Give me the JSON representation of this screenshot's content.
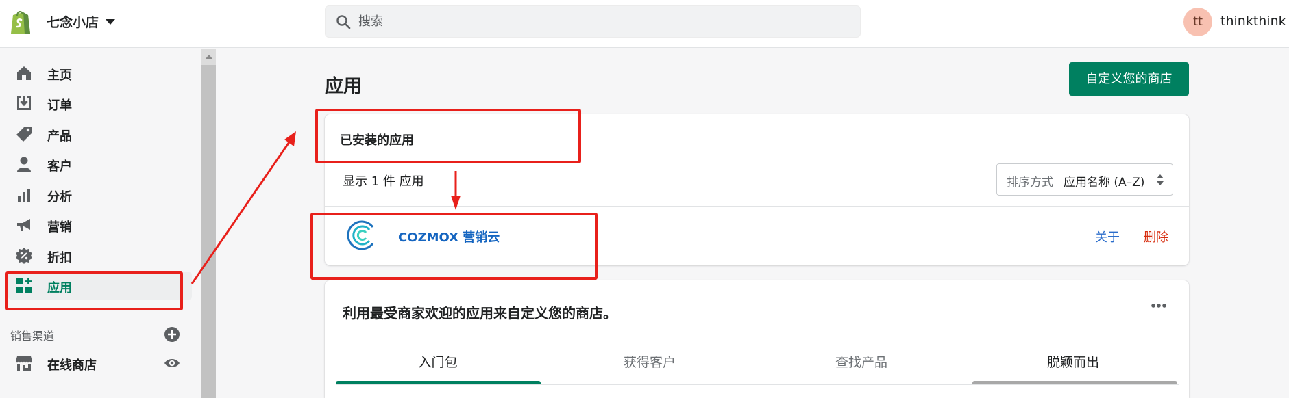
{
  "header": {
    "store_name": "七念小店",
    "search_placeholder": "搜索",
    "avatar_initials": "tt",
    "username": "thinkthink"
  },
  "sidebar": {
    "items": [
      {
        "label": "主页",
        "icon": "home-icon"
      },
      {
        "label": "订单",
        "icon": "orders-icon"
      },
      {
        "label": "产品",
        "icon": "tag-icon"
      },
      {
        "label": "客户",
        "icon": "person-icon"
      },
      {
        "label": "分析",
        "icon": "bar-chart-icon"
      },
      {
        "label": "营销",
        "icon": "megaphone-icon"
      },
      {
        "label": "折扣",
        "icon": "discount-icon"
      },
      {
        "label": "应用",
        "icon": "apps-icon",
        "active": true
      }
    ],
    "sales_channels_label": "销售渠道",
    "online_store_label": "在线商店"
  },
  "main": {
    "title": "应用",
    "customize_button": "自定义您的商店",
    "installed": {
      "title": "已安装的应用",
      "count_text": "显示 1 件 应用",
      "sort_label": "排序方式",
      "sort_value": "应用名称 (A–Z)",
      "app_name": "COZMOX 营销云",
      "about_link": "关于",
      "delete_link": "删除"
    },
    "recommend": {
      "title": "利用最受商家欢迎的应用来自定义您的商店。",
      "tabs": [
        "入门包",
        "获得客户",
        "查找产品",
        "脱颖而出"
      ]
    }
  },
  "colors": {
    "brand_green": "#008060",
    "annotation_red": "#e8201b",
    "link_blue": "#2c6ecb",
    "delete_red": "#d72c0d"
  }
}
